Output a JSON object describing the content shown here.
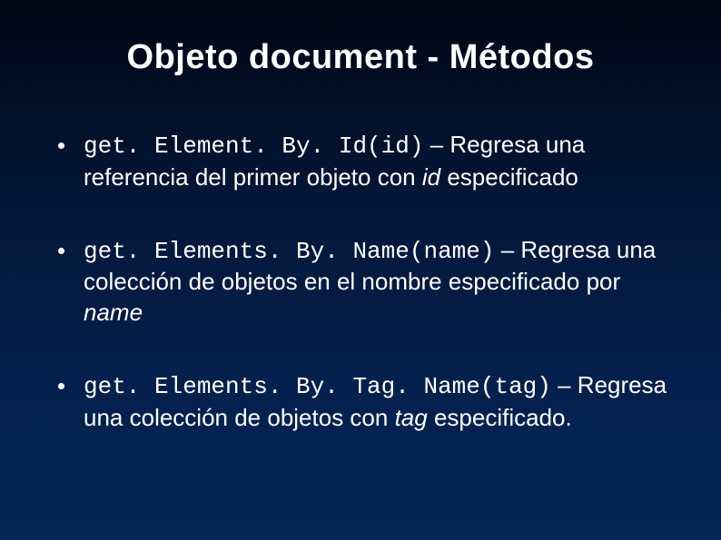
{
  "title": "Objeto document - Métodos",
  "items": [
    {
      "code": "get. Element. By. Id(id)",
      "desc1": " – Regresa una referencia del primer objeto con ",
      "em": "id",
      "desc2": " especificado"
    },
    {
      "code": "get. Elements. By. Name(name)",
      "desc1": " – Regresa una colección de objetos en el nombre especificado por ",
      "em": "name",
      "desc2": ""
    },
    {
      "code": "get. Elements. By. Tag. Name(tag)",
      "desc1": " – Regresa una colección de objetos con ",
      "em": "tag",
      "desc2": " especificado."
    }
  ]
}
